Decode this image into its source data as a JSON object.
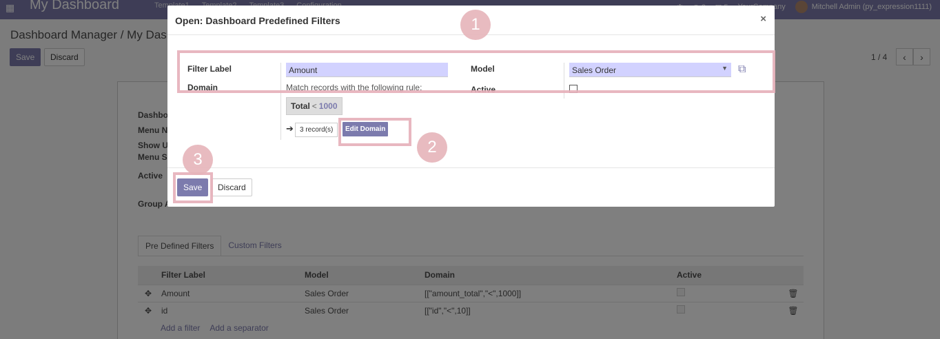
{
  "navbar": {
    "brand": "My Dashboard",
    "menu": [
      "Template1",
      "Template2",
      "Template3",
      "Configuration"
    ],
    "notification_count_1": "2",
    "notification_count_2": "5",
    "company": "YourCompany",
    "user": "Mitchell Admin (py_expression1111)"
  },
  "control_panel": {
    "breadcrumb": "Dashboard Manager / My Dashboard",
    "save": "Save",
    "discard": "Discard",
    "pager": "1 / 4"
  },
  "form": {
    "labels": {
      "dashboard": "Dashbo",
      "menu_name": "Menu Na",
      "show_under": "Show U",
      "menu_sequence": "Menu Se",
      "active": "Active",
      "group_access": "Group A"
    },
    "tabs": [
      "Pre Defined Filters",
      "Custom Filters"
    ],
    "table": {
      "columns": [
        "Filter Label",
        "Model",
        "Domain",
        "Active"
      ],
      "rows": [
        {
          "label": "Amount",
          "model": "Sales Order",
          "domain": "[[\"amount_total\",\"<\",1000]]"
        },
        {
          "label": "id",
          "model": "Sales Order",
          "domain": "[[\"id\",\"<\",10]]"
        }
      ]
    },
    "add_filter": "Add a filter",
    "add_separator": "Add a separator"
  },
  "modal": {
    "title": "Open: Dashboard Predefined Filters",
    "close": "×",
    "filter_label_label": "Filter Label",
    "filter_label_value": "Amount",
    "domain_label": "Domain",
    "domain_rule_text": "Match records with the following rule:",
    "domain_field": "Total",
    "domain_operator": "<",
    "domain_value": "1000",
    "records": "3 record(s)",
    "edit_domain": "Edit Domain",
    "model_label": "Model",
    "model_value": "Sales Order",
    "active_label": "Active",
    "save": "Save",
    "discard": "Discard"
  },
  "annotations": [
    "1",
    "2",
    "3"
  ],
  "colors": {
    "brand": "#7c7bad",
    "highlight": "#e6afb9",
    "input_bg": "#d2d2ff"
  }
}
